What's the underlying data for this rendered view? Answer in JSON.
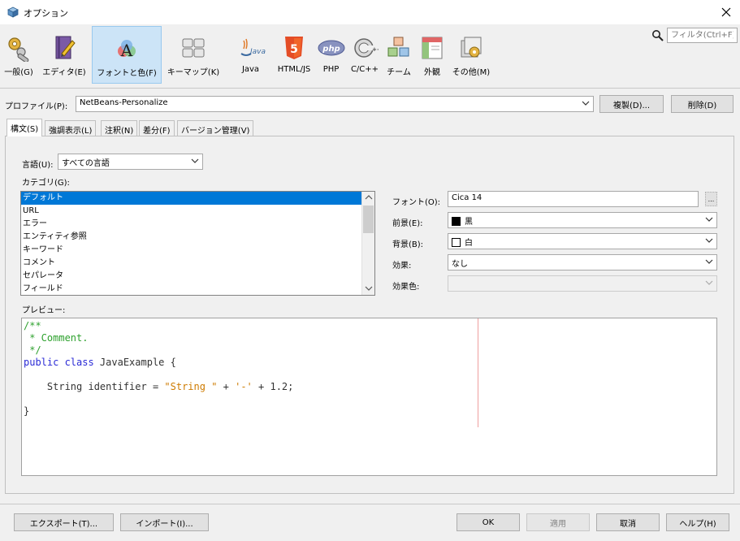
{
  "window": {
    "title": "オプション"
  },
  "toolbar": {
    "categories": [
      {
        "label": "一般(G)",
        "icon": "general-icon"
      },
      {
        "label": "エディタ(E)",
        "icon": "editor-icon"
      },
      {
        "label": "フォントと色(F)",
        "icon": "fonts-colors-icon"
      },
      {
        "label": "キーマップ(K)",
        "icon": "keymap-icon"
      },
      {
        "label": "Java",
        "icon": "java-icon"
      },
      {
        "label": "HTML/JS",
        "icon": "html5-icon"
      },
      {
        "label": "PHP",
        "icon": "php-icon"
      },
      {
        "label": "C/C++",
        "icon": "cpp-icon"
      },
      {
        "label": "チーム",
        "icon": "team-icon"
      },
      {
        "label": "外観",
        "icon": "appearance-icon"
      },
      {
        "label": "その他(M)",
        "icon": "misc-icon"
      }
    ],
    "selected_index": 2,
    "filter_placeholder": "フィルタ(Ctrl+F)"
  },
  "profile": {
    "label": "プロファイル(P):",
    "value": "NetBeans-Personalize",
    "duplicate_button": "複製(D)...",
    "delete_button": "削除(D)"
  },
  "tabs": [
    {
      "label": "構文(S)",
      "selected": true
    },
    {
      "label": "強調表示(L)",
      "selected": false
    },
    {
      "label": "注釈(N)",
      "selected": false
    },
    {
      "label": "差分(F)",
      "selected": false
    },
    {
      "label": "バージョン管理(V)",
      "selected": false
    }
  ],
  "syntax": {
    "language_label": "言語(U):",
    "language_value": "すべての言語",
    "category_label": "カテゴリ(G):",
    "categories": [
      "デフォルト",
      "URL",
      "エラー",
      "エンティティ参照",
      "キーワード",
      "コメント",
      "セパレータ",
      "フィールド"
    ],
    "selected_category_index": 0,
    "font_label": "フォント(O):",
    "font_value": "Cica 14",
    "font_button": "...",
    "foreground_label": "前景(E):",
    "foreground_value": "黒",
    "foreground_color": "#000000",
    "background_label": "背景(B):",
    "background_value": "白",
    "background_color": "#ffffff",
    "effects_label": "効果:",
    "effects_value": "なし",
    "effect_color_label": "効果色:",
    "effect_color_value": "",
    "preview_label": "プレビュー:"
  },
  "preview": {
    "lines": [
      {
        "parts": [
          {
            "text": "/**",
            "kind": "comment"
          }
        ]
      },
      {
        "parts": [
          {
            "text": " * Comment.",
            "kind": "comment"
          }
        ]
      },
      {
        "parts": [
          {
            "text": " */",
            "kind": "comment"
          }
        ]
      },
      {
        "parts": [
          {
            "text": "public class",
            "kind": "keyword"
          },
          {
            "text": " JavaExample {",
            "kind": "plain"
          }
        ]
      },
      {
        "parts": []
      },
      {
        "parts": [
          {
            "text": "    String identifier = ",
            "kind": "plain"
          },
          {
            "text": "\"String \"",
            "kind": "string"
          },
          {
            "text": " + ",
            "kind": "plain"
          },
          {
            "text": "'-'",
            "kind": "string"
          },
          {
            "text": " + 1.2;",
            "kind": "plain"
          }
        ]
      },
      {
        "parts": []
      },
      {
        "parts": [
          {
            "text": "}",
            "kind": "plain"
          }
        ]
      }
    ]
  },
  "footer": {
    "export_button": "エクスポート(T)...",
    "import_button": "インポート(I)...",
    "ok_button": "OK",
    "apply_button": "適用",
    "cancel_button": "取消",
    "help_button": "ヘルプ(H)"
  }
}
